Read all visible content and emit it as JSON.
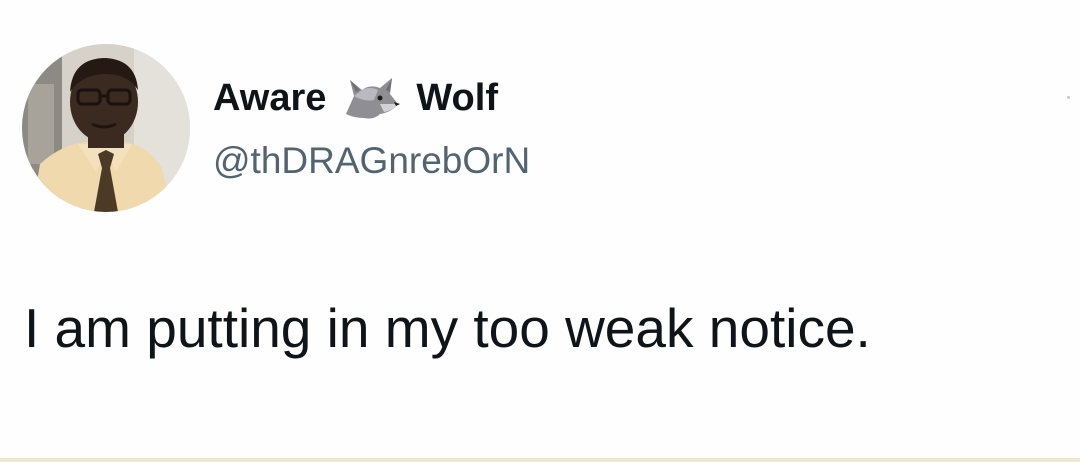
{
  "tweet": {
    "author": {
      "display_name_part1": "Aware",
      "display_name_icon": "wolf-icon",
      "display_name_part2": "Wolf",
      "handle": "@thDRAGnrebOrN",
      "avatar_icon": "profile-photo"
    },
    "text": "I am putting in my too weak notice."
  },
  "colors": {
    "background": "#fefefe",
    "text_primary": "#0f1419",
    "text_secondary": "#536471"
  }
}
